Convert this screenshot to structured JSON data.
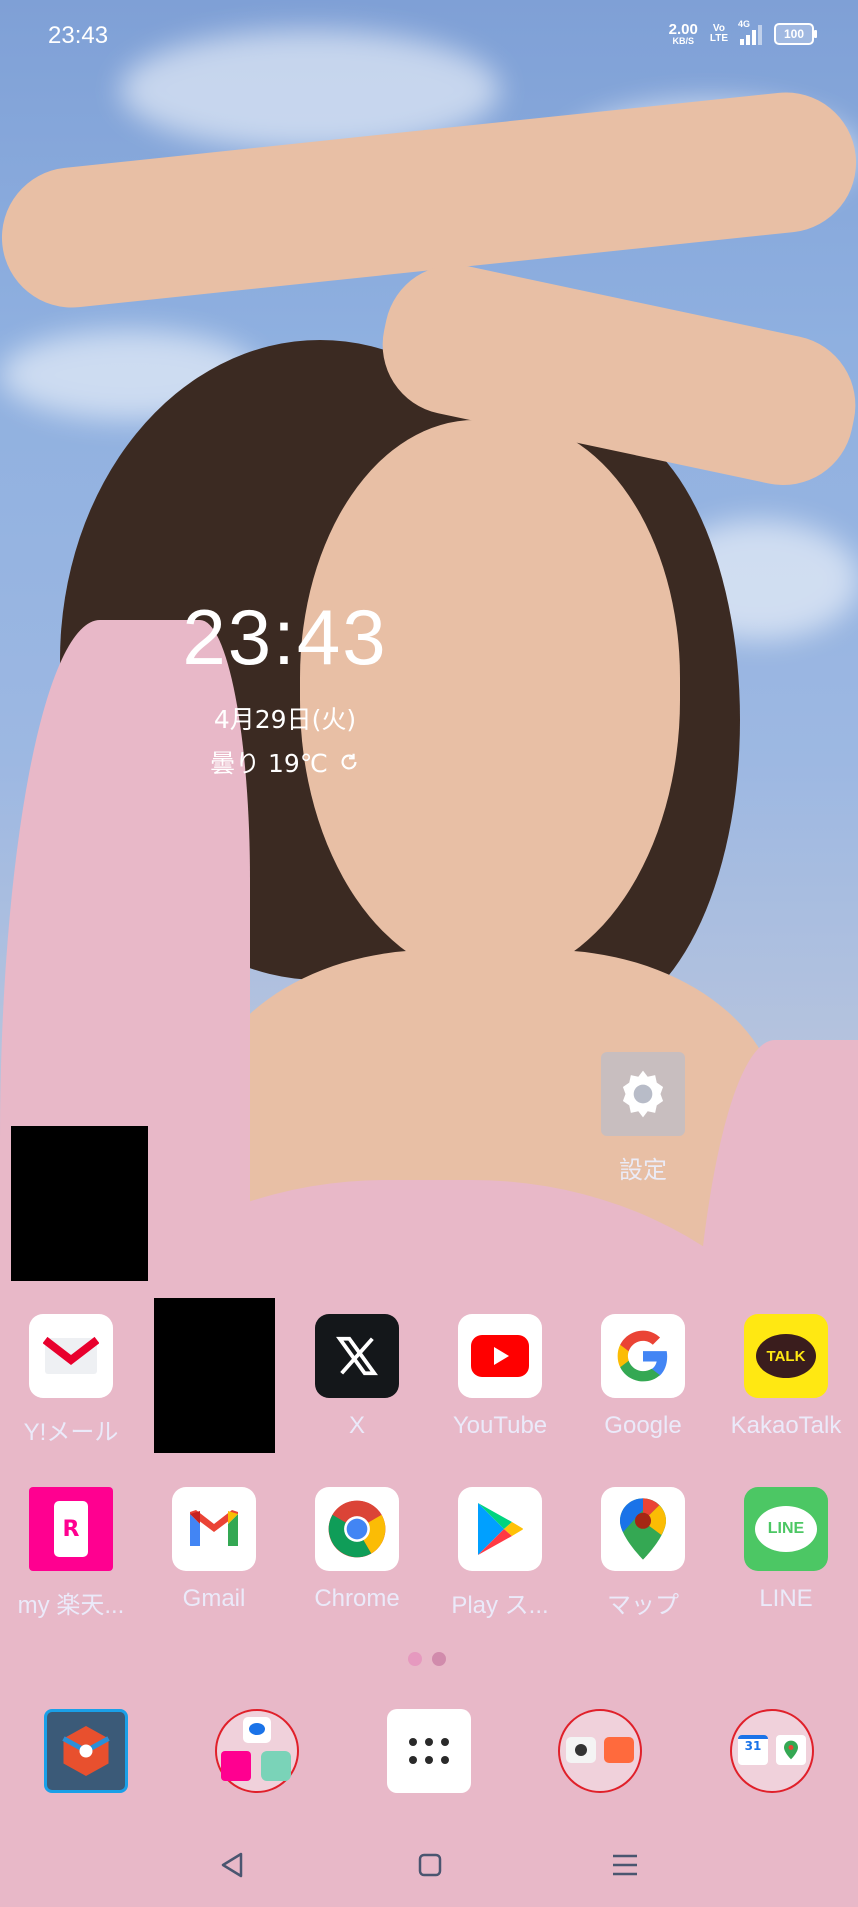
{
  "status_bar": {
    "time": "23:43",
    "net_speed_value": "2.00",
    "net_speed_unit": "KB/S",
    "volte_top": "Vo",
    "volte_bottom": "LTE",
    "network": "4G",
    "battery": "100"
  },
  "clock_widget": {
    "time": "23:43",
    "date": "4月29日(火)",
    "weather": "曇り 19℃"
  },
  "settings_shortcut": {
    "label": "設定"
  },
  "apps_row1": [
    {
      "label": "Y!メール",
      "icon": "ymail-icon"
    },
    {
      "label": "",
      "icon": "redacted"
    },
    {
      "label": "X",
      "icon": "x-icon"
    },
    {
      "label": "YouTube",
      "icon": "youtube-icon"
    },
    {
      "label": "Google",
      "icon": "google-icon"
    },
    {
      "label": "KakaoTalk",
      "icon": "kakaotalk-icon"
    }
  ],
  "apps_row2": [
    {
      "label": "my 楽天...",
      "icon": "my-rakuten-icon"
    },
    {
      "label": "Gmail",
      "icon": "gmail-icon"
    },
    {
      "label": "Chrome",
      "icon": "chrome-icon"
    },
    {
      "label": "Play ス...",
      "icon": "play-store-icon"
    },
    {
      "label": "マップ",
      "icon": "maps-icon"
    },
    {
      "label": "LINE",
      "icon": "line-icon"
    }
  ],
  "icon_text": {
    "kakao": "TALK",
    "line": "LINE",
    "rakuten_letter": "R",
    "calendar_day": "31"
  },
  "page_indicator": {
    "pages": 2,
    "current": 2
  },
  "dock": [
    {
      "icon": "nova-settings-icon"
    },
    {
      "icon": "messaging-folder-icon"
    },
    {
      "icon": "app-drawer-icon"
    },
    {
      "icon": "camera-gallery-folder-icon"
    },
    {
      "icon": "calendar-maps-folder-icon"
    }
  ],
  "colors": {
    "youtube_red": "#ff0000",
    "kakao_yellow": "#ffe812",
    "line_green": "#4cc764",
    "rakuten_magenta": "#ff0090",
    "x_black": "#14171a",
    "folder_outline": "#e0202a"
  }
}
